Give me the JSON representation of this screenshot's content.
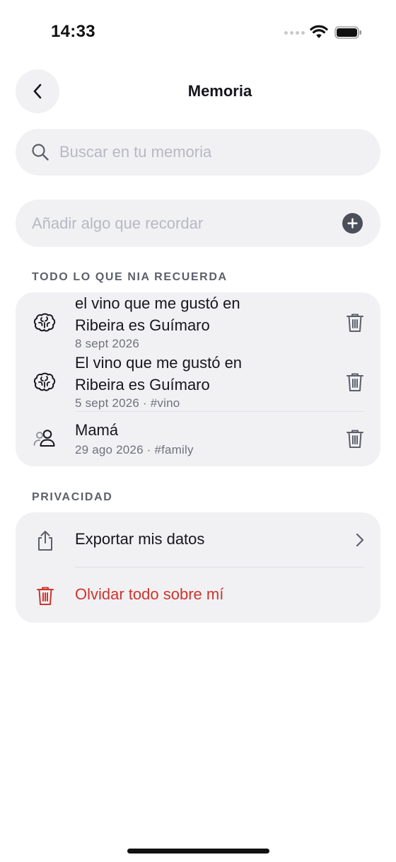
{
  "status_bar": {
    "time": "14:33"
  },
  "header": {
    "title": "Memoria"
  },
  "search": {
    "placeholder": "Buscar en tu memoria"
  },
  "add": {
    "placeholder": "Añadir algo que recordar"
  },
  "memories": {
    "section_title": "TODO LO QUE NIA RECUERDA",
    "items": [
      {
        "icon": "brain-icon",
        "title": "el vino que me gustó en Ribeira es Guímaro",
        "meta": "8 sept 2026"
      },
      {
        "icon": "brain-icon",
        "title": "El vino que me gustó en Ribeira es Guímaro",
        "meta": "5 sept 2026 · #vino"
      },
      {
        "icon": "people-icon",
        "title": "Mamá",
        "meta": "29 ago 2026 · #family"
      }
    ]
  },
  "privacy": {
    "section_title": "PRIVACIDAD",
    "export_label": "Exportar mis datos",
    "forget_label": "Olvidar todo sobre mí"
  },
  "colors": {
    "danger": "#d0342c",
    "background": "#f1f1f4",
    "muted": "#6f727c"
  }
}
